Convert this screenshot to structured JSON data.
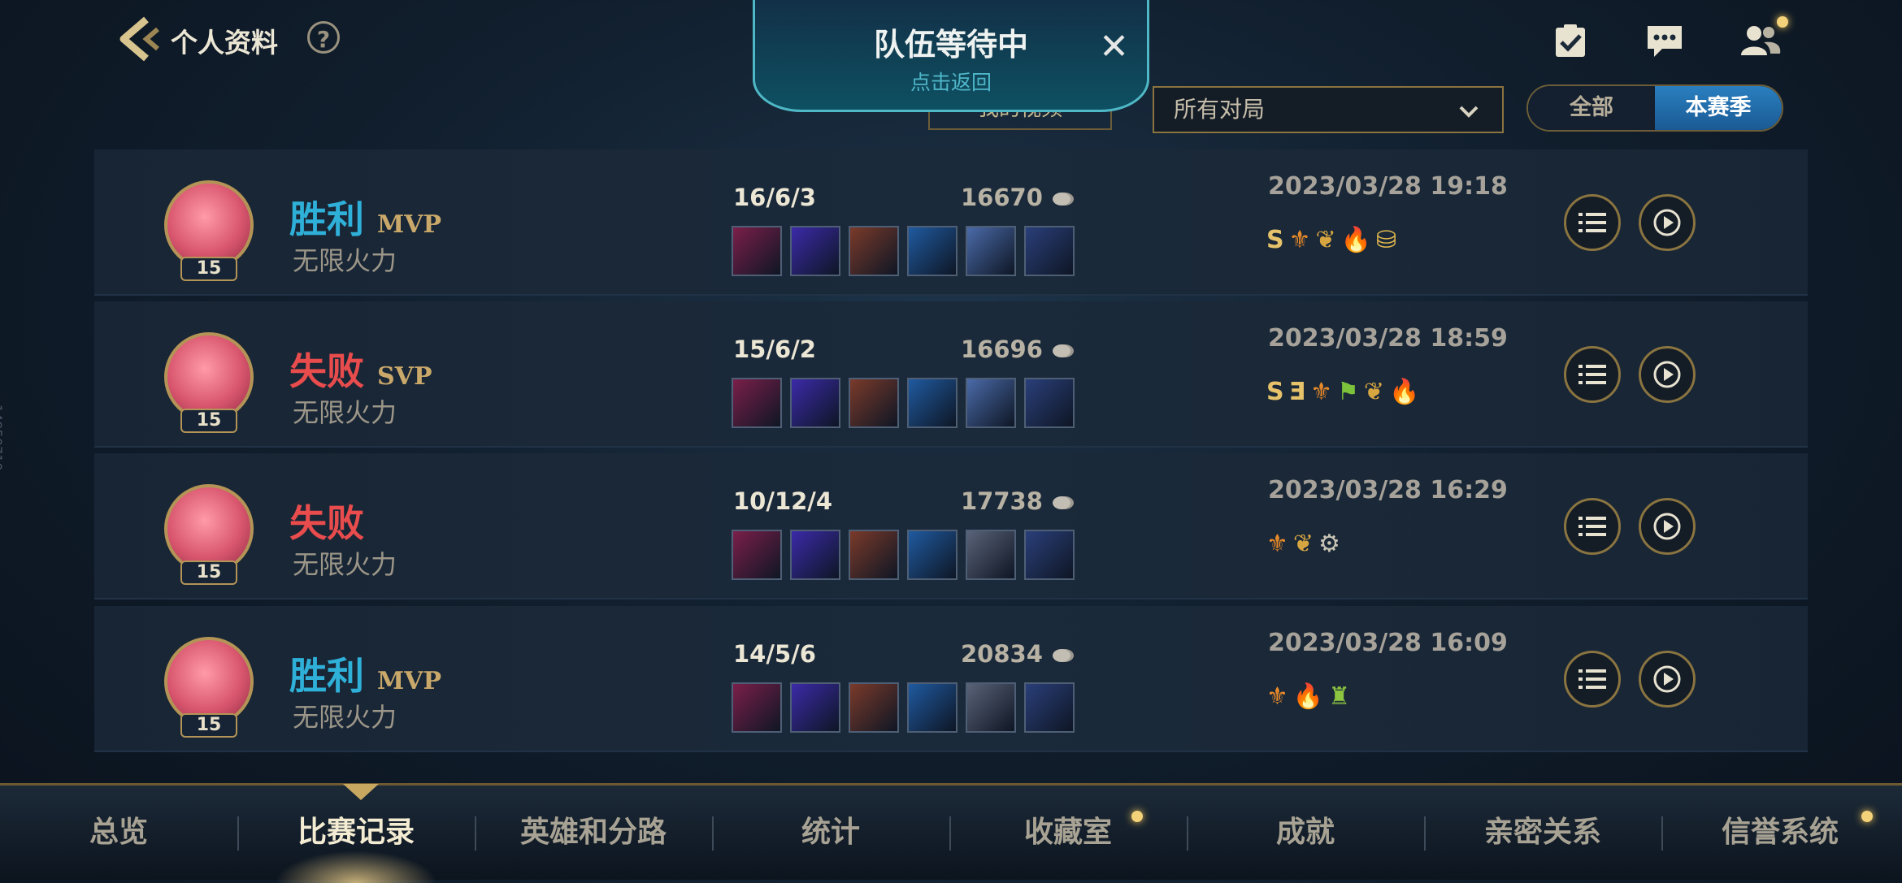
{
  "header": {
    "title": "个人资料",
    "help": "?"
  },
  "team_popup": {
    "title": "队伍等待中",
    "subtitle": "点击返回",
    "close": "✕"
  },
  "filters": {
    "my_video": "我的视频",
    "dropdown": "所有对局",
    "segment": [
      "全部",
      "本赛季"
    ],
    "active_segment": "本赛季"
  },
  "side_id": "14950710",
  "matches": [
    {
      "result": "胜利",
      "outcome": "win",
      "badge": "MVP",
      "level": "15",
      "mode": "无限火力",
      "kda": "16/6/3",
      "gold": "16670",
      "date": "2023/03/28 19:18",
      "achievements": [
        {
          "t": "S",
          "c": "#e6c26a"
        },
        {
          "t": "⚜",
          "c": "#e88a2a"
        },
        {
          "t": "❦",
          "c": "#d8a640"
        },
        {
          "t": "🔥",
          "c": "#f0a020"
        },
        {
          "t": "⛁",
          "c": "#e2b84e"
        }
      ],
      "items": [
        "#7a1f4a",
        "#3b2aa8",
        "#7a3a2a",
        "#1f5aa0",
        "#4a6aa8",
        "#2a3f7a"
      ]
    },
    {
      "result": "失败",
      "outcome": "loss",
      "badge": "SVP",
      "level": "15",
      "mode": "无限火力",
      "kda": "15/6/2",
      "gold": "16696",
      "date": "2023/03/28 18:59",
      "achievements": [
        {
          "t": "S",
          "c": "#e6c26a"
        },
        {
          "t": "Ǝ",
          "c": "#e6c26a"
        },
        {
          "t": "⚜",
          "c": "#e88a2a"
        },
        {
          "t": "⚑",
          "c": "#7cc23a"
        },
        {
          "t": "❦",
          "c": "#d8a640"
        },
        {
          "t": "🔥",
          "c": "#f0a020"
        }
      ],
      "items": [
        "#7a1f4a",
        "#3b2aa8",
        "#7a3a2a",
        "#1f5aa0",
        "#4a6aa8",
        "#2a3f7a"
      ]
    },
    {
      "result": "失败",
      "outcome": "loss",
      "badge": "",
      "level": "15",
      "mode": "无限火力",
      "kda": "10/12/4",
      "gold": "17738",
      "date": "2023/03/28 16:29",
      "achievements": [
        {
          "t": "⚜",
          "c": "#e88a2a"
        },
        {
          "t": "❦",
          "c": "#d8a640"
        },
        {
          "t": "⚙",
          "c": "#c9c4b4"
        }
      ],
      "items": [
        "#7a1f4a",
        "#3b2aa8",
        "#7a3a2a",
        "#1f5aa0",
        "#5a6278",
        "#2a3f7a"
      ]
    },
    {
      "result": "胜利",
      "outcome": "win",
      "badge": "MVP",
      "level": "15",
      "mode": "无限火力",
      "kda": "14/5/6",
      "gold": "20834",
      "date": "2023/03/28 16:09",
      "achievements": [
        {
          "t": "⚜",
          "c": "#e88a2a"
        },
        {
          "t": "🔥",
          "c": "#f0a020"
        },
        {
          "t": "♜",
          "c": "#8cc640"
        }
      ],
      "items": [
        "#7a1f4a",
        "#3b2aa8",
        "#7a3a2a",
        "#1f5aa0",
        "#5a6278",
        "#2a3f7a"
      ]
    }
  ],
  "nav": {
    "items": [
      "总览",
      "比赛记录",
      "英雄和分路",
      "统计",
      "收藏室",
      "成就",
      "亲密关系",
      "信誉系统"
    ],
    "active": "比赛记录"
  },
  "colors": {
    "win": "#2fb0d8",
    "loss": "#e84c4c",
    "gold_accent": "#b39456",
    "notify_dot": "#f4d27a"
  },
  "icons": {
    "back": "back-arrow-icon",
    "tasks": "checklist-icon",
    "chat": "chat-icon",
    "friends": "friends-icon",
    "detail": "list-icon",
    "replay": "play-icon",
    "gold": "gold-coin-icon"
  }
}
